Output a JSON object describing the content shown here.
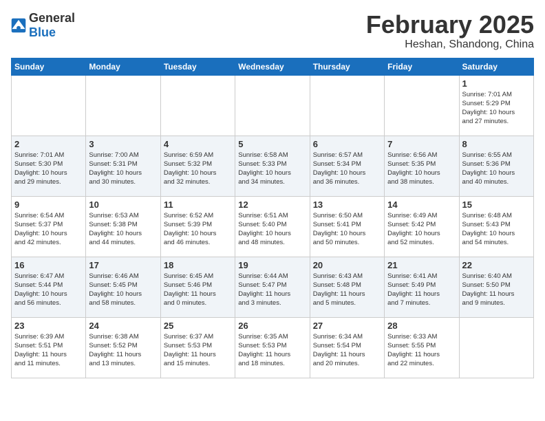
{
  "logo": {
    "general": "General",
    "blue": "Blue"
  },
  "title": "February 2025",
  "subtitle": "Heshan, Shandong, China",
  "days_of_week": [
    "Sunday",
    "Monday",
    "Tuesday",
    "Wednesday",
    "Thursday",
    "Friday",
    "Saturday"
  ],
  "weeks": [
    [
      {
        "day": "",
        "info": ""
      },
      {
        "day": "",
        "info": ""
      },
      {
        "day": "",
        "info": ""
      },
      {
        "day": "",
        "info": ""
      },
      {
        "day": "",
        "info": ""
      },
      {
        "day": "",
        "info": ""
      },
      {
        "day": "1",
        "info": "Sunrise: 7:01 AM\nSunset: 5:29 PM\nDaylight: 10 hours\nand 27 minutes."
      }
    ],
    [
      {
        "day": "2",
        "info": "Sunrise: 7:01 AM\nSunset: 5:30 PM\nDaylight: 10 hours\nand 29 minutes."
      },
      {
        "day": "3",
        "info": "Sunrise: 7:00 AM\nSunset: 5:31 PM\nDaylight: 10 hours\nand 30 minutes."
      },
      {
        "day": "4",
        "info": "Sunrise: 6:59 AM\nSunset: 5:32 PM\nDaylight: 10 hours\nand 32 minutes."
      },
      {
        "day": "5",
        "info": "Sunrise: 6:58 AM\nSunset: 5:33 PM\nDaylight: 10 hours\nand 34 minutes."
      },
      {
        "day": "6",
        "info": "Sunrise: 6:57 AM\nSunset: 5:34 PM\nDaylight: 10 hours\nand 36 minutes."
      },
      {
        "day": "7",
        "info": "Sunrise: 6:56 AM\nSunset: 5:35 PM\nDaylight: 10 hours\nand 38 minutes."
      },
      {
        "day": "8",
        "info": "Sunrise: 6:55 AM\nSunset: 5:36 PM\nDaylight: 10 hours\nand 40 minutes."
      }
    ],
    [
      {
        "day": "9",
        "info": "Sunrise: 6:54 AM\nSunset: 5:37 PM\nDaylight: 10 hours\nand 42 minutes."
      },
      {
        "day": "10",
        "info": "Sunrise: 6:53 AM\nSunset: 5:38 PM\nDaylight: 10 hours\nand 44 minutes."
      },
      {
        "day": "11",
        "info": "Sunrise: 6:52 AM\nSunset: 5:39 PM\nDaylight: 10 hours\nand 46 minutes."
      },
      {
        "day": "12",
        "info": "Sunrise: 6:51 AM\nSunset: 5:40 PM\nDaylight: 10 hours\nand 48 minutes."
      },
      {
        "day": "13",
        "info": "Sunrise: 6:50 AM\nSunset: 5:41 PM\nDaylight: 10 hours\nand 50 minutes."
      },
      {
        "day": "14",
        "info": "Sunrise: 6:49 AM\nSunset: 5:42 PM\nDaylight: 10 hours\nand 52 minutes."
      },
      {
        "day": "15",
        "info": "Sunrise: 6:48 AM\nSunset: 5:43 PM\nDaylight: 10 hours\nand 54 minutes."
      }
    ],
    [
      {
        "day": "16",
        "info": "Sunrise: 6:47 AM\nSunset: 5:44 PM\nDaylight: 10 hours\nand 56 minutes."
      },
      {
        "day": "17",
        "info": "Sunrise: 6:46 AM\nSunset: 5:45 PM\nDaylight: 10 hours\nand 58 minutes."
      },
      {
        "day": "18",
        "info": "Sunrise: 6:45 AM\nSunset: 5:46 PM\nDaylight: 11 hours\nand 0 minutes."
      },
      {
        "day": "19",
        "info": "Sunrise: 6:44 AM\nSunset: 5:47 PM\nDaylight: 11 hours\nand 3 minutes."
      },
      {
        "day": "20",
        "info": "Sunrise: 6:43 AM\nSunset: 5:48 PM\nDaylight: 11 hours\nand 5 minutes."
      },
      {
        "day": "21",
        "info": "Sunrise: 6:41 AM\nSunset: 5:49 PM\nDaylight: 11 hours\nand 7 minutes."
      },
      {
        "day": "22",
        "info": "Sunrise: 6:40 AM\nSunset: 5:50 PM\nDaylight: 11 hours\nand 9 minutes."
      }
    ],
    [
      {
        "day": "23",
        "info": "Sunrise: 6:39 AM\nSunset: 5:51 PM\nDaylight: 11 hours\nand 11 minutes."
      },
      {
        "day": "24",
        "info": "Sunrise: 6:38 AM\nSunset: 5:52 PM\nDaylight: 11 hours\nand 13 minutes."
      },
      {
        "day": "25",
        "info": "Sunrise: 6:37 AM\nSunset: 5:53 PM\nDaylight: 11 hours\nand 15 minutes."
      },
      {
        "day": "26",
        "info": "Sunrise: 6:35 AM\nSunset: 5:53 PM\nDaylight: 11 hours\nand 18 minutes."
      },
      {
        "day": "27",
        "info": "Sunrise: 6:34 AM\nSunset: 5:54 PM\nDaylight: 11 hours\nand 20 minutes."
      },
      {
        "day": "28",
        "info": "Sunrise: 6:33 AM\nSunset: 5:55 PM\nDaylight: 11 hours\nand 22 minutes."
      },
      {
        "day": "",
        "info": ""
      }
    ]
  ]
}
